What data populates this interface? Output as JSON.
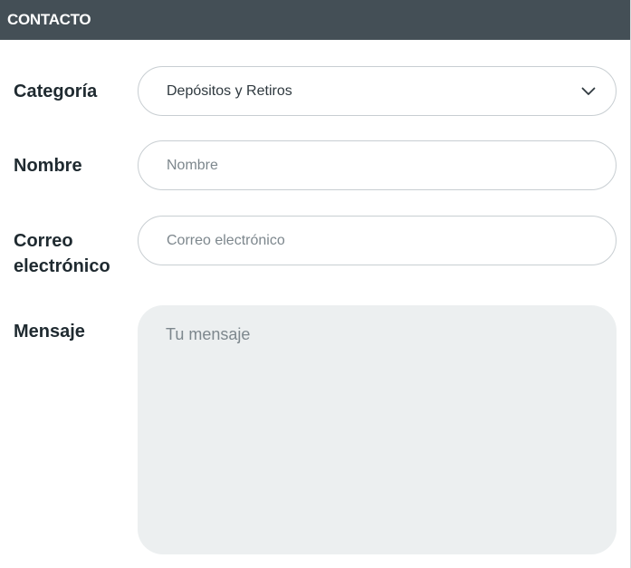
{
  "header": {
    "title": "CONTACTO"
  },
  "form": {
    "category": {
      "label": "Categoría",
      "selected": "Depósitos y Retiros",
      "icon": "chevron-down-icon"
    },
    "name": {
      "label": "Nombre",
      "value": "",
      "placeholder": "Nombre"
    },
    "email": {
      "label_line1": "Correo",
      "label_line2": "electrónico",
      "value": "",
      "placeholder": "Correo electrónico"
    },
    "message": {
      "label": "Mensaje",
      "value": "",
      "placeholder": "Tu mensaje"
    }
  },
  "colors": {
    "header_bg": "#444f56",
    "text_dark": "#1f2a30",
    "field_border": "#c8ced2",
    "textarea_bg": "#eceff0"
  }
}
